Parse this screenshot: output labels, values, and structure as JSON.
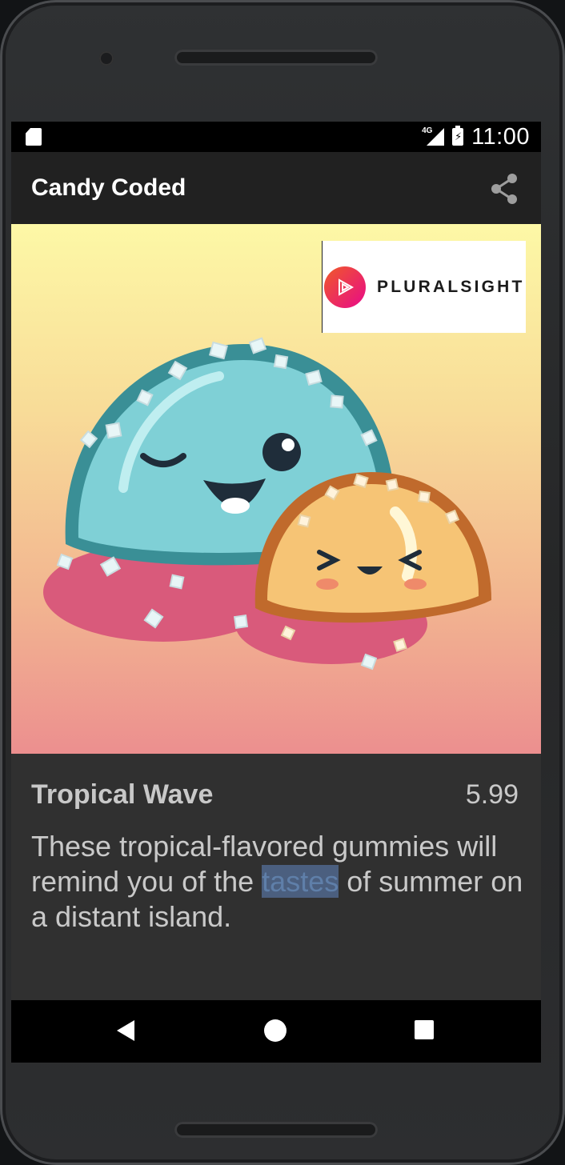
{
  "status_bar": {
    "network_label": "4G",
    "time": "11:00"
  },
  "app_bar": {
    "title": "Candy Coded",
    "share_icon": "share-icon"
  },
  "hero": {
    "image_subject": "candy-gummies-illustration",
    "badge": {
      "text": "PLURALSIGHT",
      "logo_icon": "pluralsight-play-icon",
      "colors": [
        "#f05a28",
        "#e80a89"
      ]
    }
  },
  "candy": {
    "name": "Tropical Wave",
    "price": "5.99",
    "description_before": "These tropical-flavored gummies will remind you of the ",
    "description_highlight": "tastes",
    "description_after": " of summer on a distant island."
  },
  "nav": {
    "back_icon": "back-triangle-icon",
    "home_icon": "home-circle-icon",
    "recents_icon": "recents-square-icon"
  },
  "colors": {
    "app_bar": "#212121",
    "body": "#303030",
    "text": "#c8c8c8",
    "highlight": "#4b5f7f"
  }
}
